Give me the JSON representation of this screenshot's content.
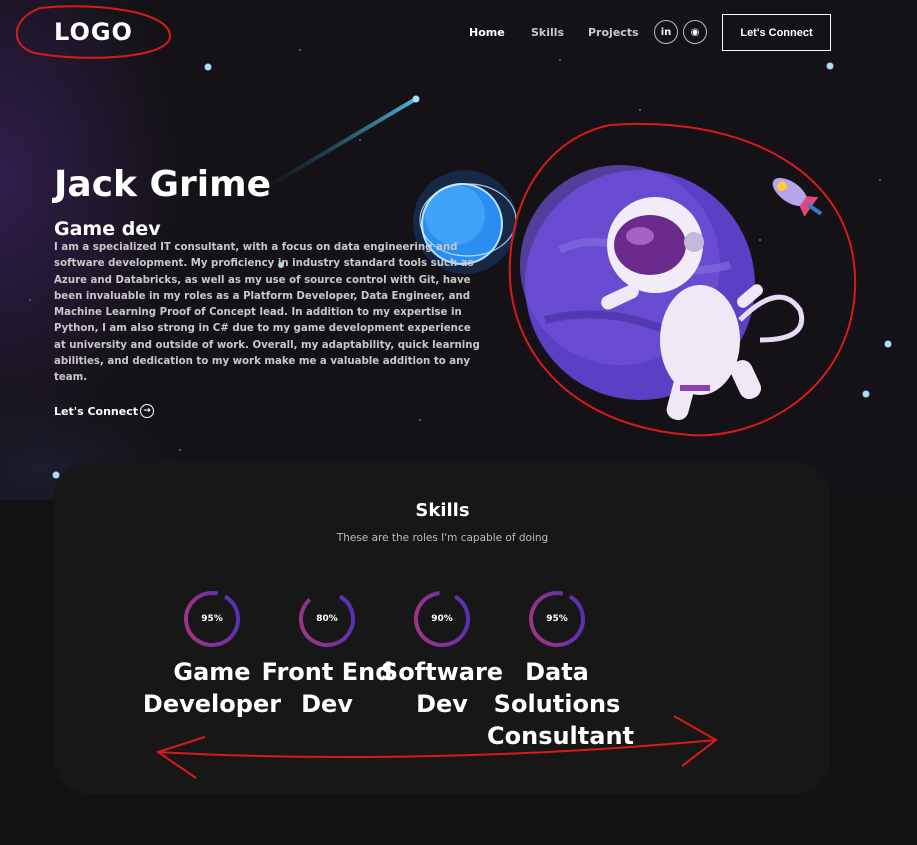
{
  "nav": {
    "logo": "LOGO",
    "links": [
      "Home",
      "Skills",
      "Projects"
    ],
    "social": [
      {
        "icon": "linkedin-icon",
        "glyph": "in"
      },
      {
        "icon": "github-icon",
        "glyph": "◉"
      }
    ],
    "cta": "Let's Connect"
  },
  "hero": {
    "name": "Jack Grime",
    "role": "Game dev",
    "bio": "I am a specialized IT consultant, with a focus on data engineering and software development. My proficiency in industry standard tools such as Azure and Databricks, as well as my use of source control with Git, have been invaluable in my roles as a Platform Developer, Data Engineer, and Machine Learning Proof of Concept lead. In addition to my expertise in Python, I am also strong in C# due to my game development experience at university and outside of work. Overall, my adaptability, quick learning abilities, and dedication to my work make me a valuable addition to any team.",
    "cta": "Let's Connect",
    "cta_icon": "→"
  },
  "skills": {
    "title": "Skills",
    "subtitle": "These are the roles I'm capable of doing",
    "items": [
      {
        "percent": 95,
        "label": "95%",
        "name": "Game Developer"
      },
      {
        "percent": 80,
        "label": "80%",
        "name": "Front End Dev"
      },
      {
        "percent": 90,
        "label": "90%",
        "name": "Software Dev"
      },
      {
        "percent": 95,
        "label": "95%",
        "name": "Data Solutions Consultant"
      }
    ]
  },
  "colors": {
    "ring_start": "#aa367c",
    "ring_end": "#4a2fbd",
    "annotation": "#d91a1a"
  }
}
